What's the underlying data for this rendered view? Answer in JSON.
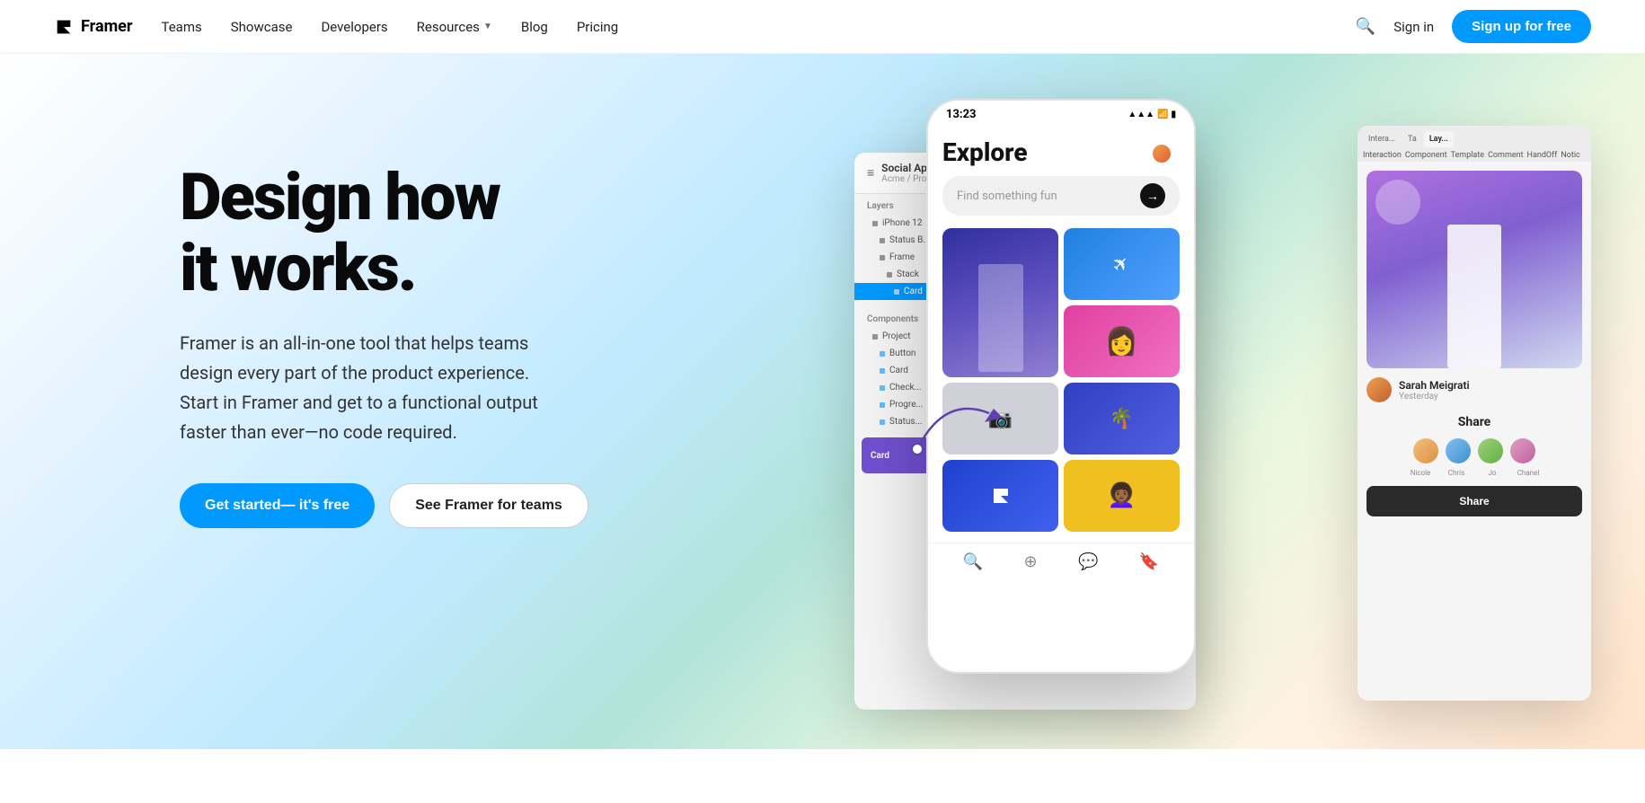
{
  "navbar": {
    "logo_text": "Framer",
    "nav_items": [
      {
        "label": "Teams",
        "href": "#"
      },
      {
        "label": "Showcase",
        "href": "#"
      },
      {
        "label": "Developers",
        "href": "#"
      },
      {
        "label": "Resources",
        "href": "#",
        "has_dropdown": true
      },
      {
        "label": "Blog",
        "href": "#"
      },
      {
        "label": "Pricing",
        "href": "#"
      }
    ],
    "signin_label": "Sign in",
    "signup_label": "Sign up for free"
  },
  "hero": {
    "title_line1": "Design how",
    "title_line2": "it works.",
    "subtitle": "Framer is an all-in-one tool that helps teams design every part of the product experience. Start in Framer and get to a functional output faster than ever—no code required.",
    "cta_primary": "Get started— it's free",
    "cta_secondary": "See Framer for teams"
  },
  "mockup": {
    "phone": {
      "time": "13:23",
      "explore_title": "Explore",
      "search_placeholder": "Find something fun",
      "nav_icons": [
        "🔍",
        "⊕",
        "◯",
        "⊓"
      ]
    },
    "left_panel": {
      "title": "Social App",
      "breadcrumb": "Acme / Prototyp",
      "layers_label": "Layers",
      "tree_items": [
        "iPhone 12",
        "Status B...",
        "Frame",
        "Stack",
        "Card"
      ],
      "components_label": "Components",
      "comp_items": [
        "Project",
        "Button",
        "Card",
        "Check...",
        "Progre...",
        "Status..."
      ]
    },
    "right_panel": {
      "tabs": [
        "Interaction",
        "Component",
        "Template",
        "Comment",
        "Handoff",
        "Nolic"
      ],
      "tab_right_labels": [
        "Intera...",
        "Ta",
        "Lay..."
      ],
      "username": "Sarah Meigrati",
      "time": "Yesterday",
      "share_title": "Share",
      "avatar_labels": [
        "Nicole",
        "Chris",
        "Jo",
        "Chanel"
      ],
      "share_button": "Share"
    }
  }
}
